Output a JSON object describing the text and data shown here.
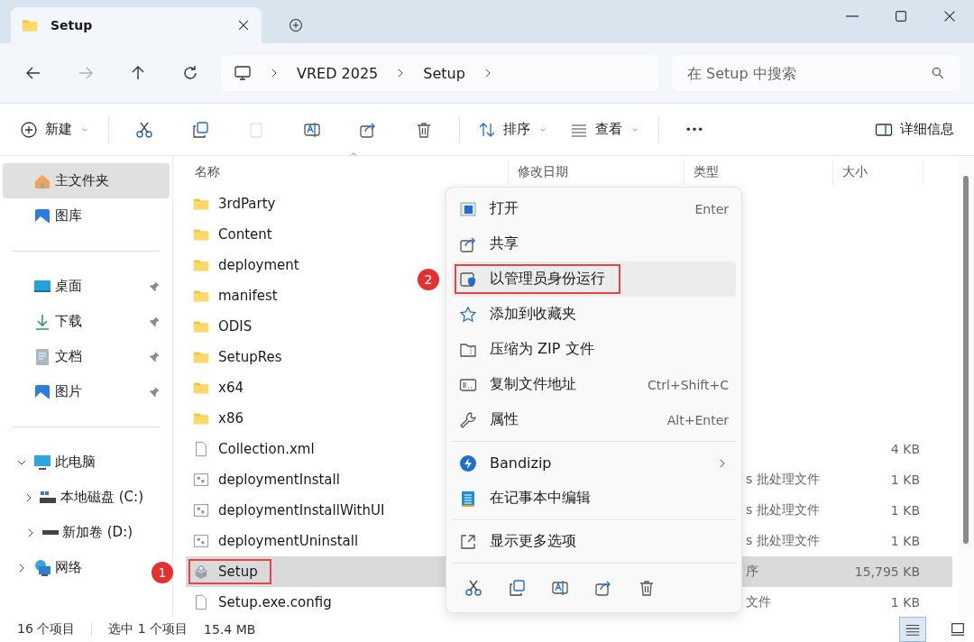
{
  "window": {
    "tab_title": "Setup"
  },
  "nav": {
    "back_disabled": false,
    "forward_disabled": true,
    "breadcrumb": [
      "VRED 2025",
      "Setup"
    ],
    "search": {
      "placeholder": "在 Setup 中搜索"
    }
  },
  "toolbar": {
    "new": "新建",
    "icon_buttons": [
      {
        "disabled": false
      },
      {
        "disabled": false
      },
      {
        "disabled": true
      },
      {
        "disabled": false
      },
      {
        "disabled": false
      },
      {
        "disabled": false
      }
    ],
    "sort": "排序",
    "view": "查看",
    "details": "详细信息"
  },
  "sidebar": {
    "sections": [
      [
        {
          "label": "主文件夹",
          "selected": true,
          "pinned": false
        },
        {
          "label": "图库",
          "selected": false,
          "pinned": false
        }
      ],
      [
        {
          "label": "桌面",
          "selected": false,
          "pinned": true
        },
        {
          "label": "下载",
          "selected": false,
          "pinned": true
        },
        {
          "label": "文档",
          "selected": false,
          "pinned": true
        },
        {
          "label": "图片",
          "selected": false,
          "pinned": true
        }
      ],
      [
        {
          "label": "此电脑",
          "selected": false,
          "expanded": true,
          "children": [
            {
              "label": "本地磁盘 (C:)",
              "selected": false,
              "expanded": false
            },
            {
              "label": "新加卷 (D:)",
              "selected": false,
              "expanded": false
            }
          ]
        },
        {
          "label": "网络",
          "selected": false,
          "expanded": false
        }
      ]
    ]
  },
  "table": {
    "columns": [
      "名称",
      "修改日期",
      "类型",
      "大小"
    ],
    "rows": [
      {
        "name": "3rdParty",
        "kind": "folder",
        "selected": false,
        "annotated": false
      },
      {
        "name": "Content",
        "kind": "folder",
        "selected": false,
        "annotated": false
      },
      {
        "name": "deployment",
        "kind": "folder",
        "selected": false,
        "annotated": false
      },
      {
        "name": "manifest",
        "kind": "folder",
        "selected": false,
        "annotated": false
      },
      {
        "name": "ODIS",
        "kind": "folder",
        "selected": false,
        "annotated": false
      },
      {
        "name": "SetupRes",
        "kind": "folder",
        "selected": false,
        "annotated": false
      },
      {
        "name": "x64",
        "kind": "folder",
        "selected": false,
        "annotated": false
      },
      {
        "name": "x86",
        "kind": "folder",
        "selected": false,
        "annotated": false
      },
      {
        "name": "Collection.xml",
        "kind": "file",
        "size": "4 KB",
        "selected": false,
        "annotated": false
      },
      {
        "name": "deploymentInstall",
        "kind": "script",
        "type": "s 批处理文件",
        "size": "1 KB",
        "selected": false,
        "annotated": false
      },
      {
        "name": "deploymentInstallWithUI",
        "kind": "script",
        "type": "s 批处理文件",
        "size": "1 KB",
        "selected": false,
        "annotated": false
      },
      {
        "name": "deploymentUninstall",
        "kind": "script",
        "type": "s 批处理文件",
        "size": "1 KB",
        "selected": false,
        "annotated": false
      },
      {
        "name": "Setup",
        "kind": "app",
        "type": "序",
        "size": "15,795 KB",
        "selected": true,
        "annotated": true
      },
      {
        "name": "Setup.exe.config",
        "kind": "file",
        "type": "文件",
        "size": "1 KB",
        "selected": false,
        "annotated": false
      }
    ]
  },
  "context_menu": {
    "groups": [
      [
        {
          "label": "打开",
          "shortcut": "Enter",
          "highlighted": false,
          "annotated": false
        },
        {
          "label": "共享",
          "highlighted": false,
          "annotated": false
        },
        {
          "label": "以管理员身份运行",
          "highlighted": true,
          "annotated": true
        },
        {
          "label": "添加到收藏夹",
          "highlighted": false,
          "annotated": false
        },
        {
          "label": "压缩为 ZIP 文件",
          "highlighted": false,
          "annotated": false
        },
        {
          "label": "复制文件地址",
          "shortcut": "Ctrl+Shift+C",
          "highlighted": false,
          "annotated": false
        },
        {
          "label": "属性",
          "shortcut": "Alt+Enter",
          "highlighted": false,
          "annotated": false
        }
      ],
      [
        {
          "label": "Bandizip",
          "submenu": true,
          "highlighted": false,
          "annotated": false
        },
        {
          "label": "在记事本中编辑",
          "highlighted": false,
          "annotated": false
        }
      ],
      [
        {
          "label": "显示更多选项",
          "highlighted": false,
          "annotated": false
        }
      ]
    ]
  },
  "markers": [
    "1",
    "2"
  ],
  "status_bar": {
    "item_count": "16 个项目",
    "selection": "选中 1 个项目",
    "selection_size": "15.4 MB",
    "views": [
      {
        "selected": true
      },
      {
        "selected": false
      }
    ]
  }
}
